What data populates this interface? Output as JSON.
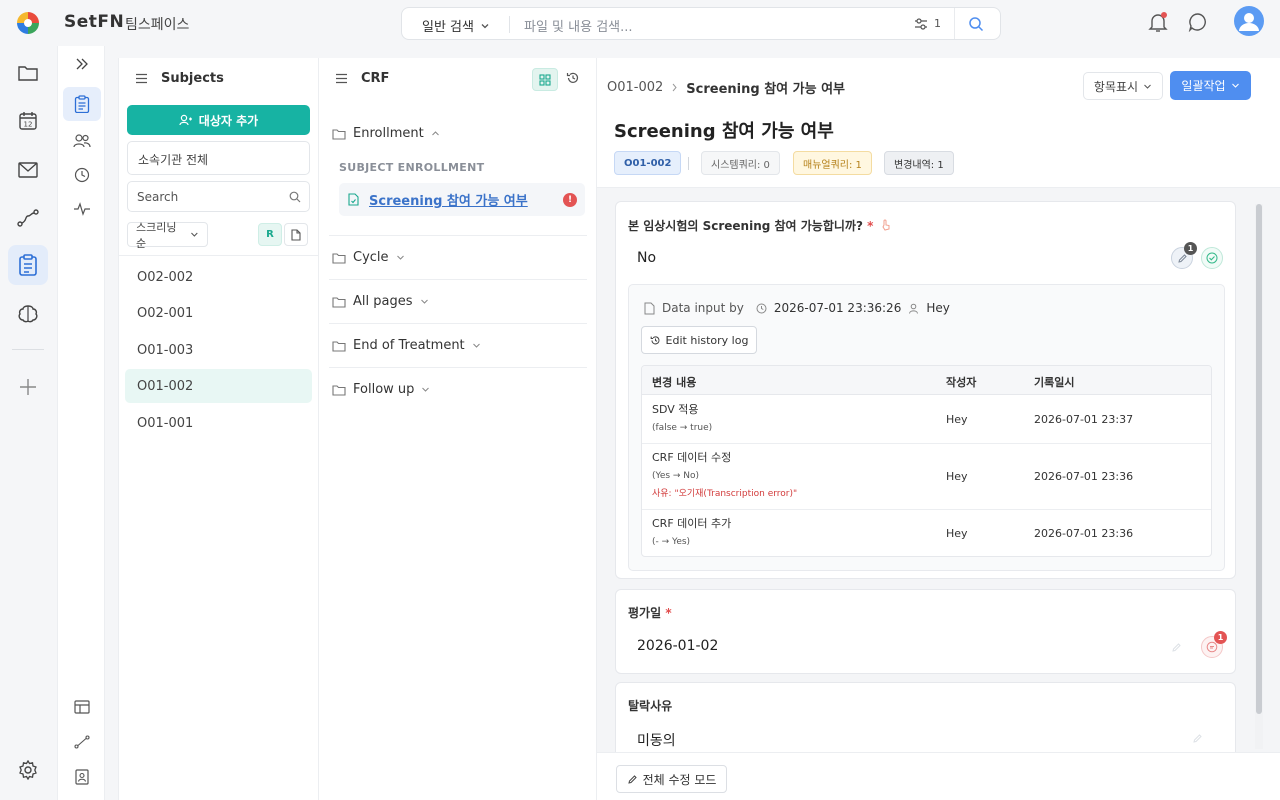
{
  "brand": "SetFN",
  "workspace": "팀스페이스",
  "search": {
    "type_label": "일반 검색",
    "placeholder": "파일 및 내용 검색...",
    "filter_count": "1"
  },
  "subjects_panel": {
    "title": "Subjects",
    "add_button": "대상자 추가",
    "org_select": "소속기관 전체",
    "search_placeholder": "Search",
    "sort_label": "스크리닝순",
    "r_label": "R",
    "items": [
      "O02-002",
      "O02-001",
      "O01-003",
      "O01-002",
      "O01-001"
    ]
  },
  "crf_panel": {
    "title": "CRF",
    "groups": [
      "Enrollment",
      "Cycle",
      "All pages",
      "End of Treatment",
      "Follow up"
    ],
    "section_label": "SUBJECT ENROLLMENT",
    "page_label": "Screening 참여 가능 여부",
    "error_mark": "!"
  },
  "main": {
    "breadcrumb_subject": "O01-002",
    "breadcrumb_page": "Screening 참여 가능 여부",
    "display_items_button": "항목표시",
    "bulk_action_button": "일괄작업",
    "title": "Screening 참여 가능 여부",
    "chips": {
      "subject": "O01-002",
      "system_query": "시스템쿼리: 0",
      "manual_query": "매뉴얼쿼리: 1",
      "change_history": "변경내역: 1"
    },
    "q1": {
      "label": "본 임상시험의 Screening 참여 가능합니까?",
      "required_mark": "*",
      "answer": "No",
      "badge": "1",
      "data_input_label": "Data input by",
      "data_input_time": "2026-07-01 23:36:26",
      "data_input_user": "Hey",
      "edit_history_button": "Edit history log",
      "table": {
        "headers": [
          "변경 내용",
          "작성자",
          "기록일시"
        ],
        "rows": [
          {
            "title": "SDV 적용",
            "detail": "(false → true)",
            "reason": "",
            "author": "Hey",
            "date": "2026-07-01 23:37"
          },
          {
            "title": "CRF 데이터 수정",
            "detail": "(Yes → No)",
            "reason": "사유: \"오기재(Transcription error)\"",
            "author": "Hey",
            "date": "2026-07-01 23:36"
          },
          {
            "title": "CRF 데이터 추가",
            "detail": "(- → Yes)",
            "reason": "",
            "author": "Hey",
            "date": "2026-07-01 23:36"
          }
        ]
      }
    },
    "q2": {
      "label": "평가일",
      "required_mark": "*",
      "answer": "2026-01-02",
      "badge": "1"
    },
    "q3": {
      "label": "탈락사유",
      "answer": "미동의"
    },
    "edit_all_button": "전체 수정 모드"
  },
  "colors": {
    "teal": "#17b3a3",
    "blue": "#4f8ef0",
    "red": "#e35454"
  }
}
